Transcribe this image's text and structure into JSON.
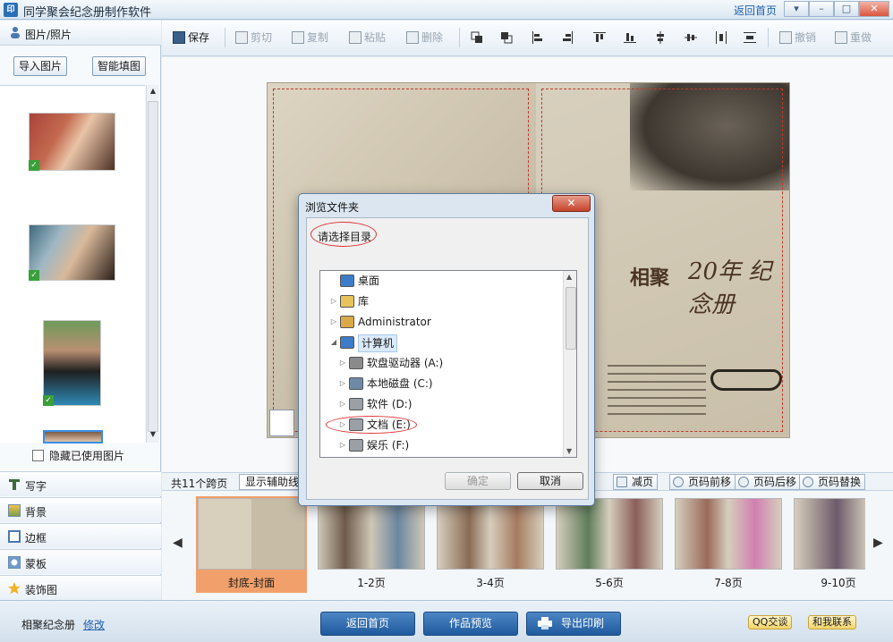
{
  "app": {
    "title": "同学聚会纪念册制作软件",
    "icon_text": "印",
    "home_link": "返回首页",
    "window_buttons": [
      "▾",
      "–",
      "□",
      "✕"
    ]
  },
  "left_panel": {
    "header": "图片/照片",
    "import_button": "导入图片",
    "autofill_button": "智能填图",
    "thumbnails": [
      {
        "name": "photo-1",
        "colors": [
          "#a8433a",
          "#e9c4a7"
        ],
        "used": true
      },
      {
        "name": "photo-2",
        "colors": [
          "#3f6a7e",
          "#d9b99a"
        ],
        "used": true
      },
      {
        "name": "photo-3",
        "colors": [
          "#2e8ab5",
          "#b98f72"
        ],
        "used": true
      },
      {
        "name": "photo-4",
        "colors": [
          "#7b5b45",
          "#e0c5aa"
        ],
        "used": false
      }
    ],
    "check_symbol": "✓",
    "hide_used_label": "隐藏已使用图片",
    "tools": [
      "写字",
      "背景",
      "边框",
      "蒙板",
      "装饰图"
    ]
  },
  "toolbar": {
    "items": [
      {
        "label": "保存",
        "active": true
      },
      {
        "label": "剪切",
        "active": false
      },
      {
        "label": "复制",
        "active": false
      },
      {
        "label": "粘贴",
        "active": false
      },
      {
        "label": "删除",
        "active": false
      },
      {
        "label": "撤销",
        "active": false
      },
      {
        "label": "重做",
        "active": false
      }
    ]
  },
  "canvas": {
    "cover_title": "相聚",
    "cover_subtitle": "20年 纪念册"
  },
  "pagebar": {
    "page_count": "共11个跨页",
    "show_guides": "显示辅助线",
    "buttons": [
      "减页",
      "页码前移",
      "页码后移",
      "页码替换"
    ]
  },
  "filmstrip": {
    "left_arrow": "◀",
    "right_arrow": "▶",
    "items": [
      {
        "label": "封底-封面",
        "selected": true
      },
      {
        "label": "1-2页",
        "selected": false
      },
      {
        "label": "3-4页",
        "selected": false
      },
      {
        "label": "5-6页",
        "selected": false
      },
      {
        "label": "7-8页",
        "selected": false
      },
      {
        "label": "9-10页",
        "selected": false
      }
    ]
  },
  "bottombar": {
    "project_name": "相聚纪念册",
    "edit_link": "修改",
    "back_home": "返回首页",
    "preview": "作品预览",
    "export_print": "导出印刷",
    "qq_chat": "QQ交谈",
    "contact_us": "和我联系"
  },
  "dialog": {
    "title": "浏览文件夹",
    "close_symbol": "✕",
    "prompt": "请选择目录",
    "tree": [
      {
        "label": "桌面",
        "indent": 0,
        "expander": "",
        "icon_color": "#3d7cc9",
        "selected": false
      },
      {
        "label": "库",
        "indent": 0,
        "expander": "▷",
        "icon_color": "#e6c35c",
        "selected": false
      },
      {
        "label": "Administrator",
        "indent": 0,
        "expander": "▷",
        "icon_color": "#d9a94a",
        "selected": false
      },
      {
        "label": "计算机",
        "indent": 0,
        "expander": "◢",
        "icon_color": "#3d7cc9",
        "selected": true
      },
      {
        "label": "软盘驱动器 (A:)",
        "indent": 1,
        "expander": "▷",
        "icon_color": "#8a8a8a",
        "selected": false
      },
      {
        "label": "本地磁盘 (C:)",
        "indent": 1,
        "expander": "▷",
        "icon_color": "#6f8aa6",
        "selected": false
      },
      {
        "label": "软件 (D:)",
        "indent": 1,
        "expander": "▷",
        "icon_color": "#9aa0a6",
        "selected": false
      },
      {
        "label": "文档 (E:)",
        "indent": 1,
        "expander": "▷",
        "icon_color": "#9aa0a6",
        "selected": false
      },
      {
        "label": "娱乐 (F:)",
        "indent": 1,
        "expander": "▷",
        "icon_color": "#9aa0a6",
        "selected": false
      }
    ],
    "ok_button": "确定",
    "cancel_button": "取消"
  }
}
